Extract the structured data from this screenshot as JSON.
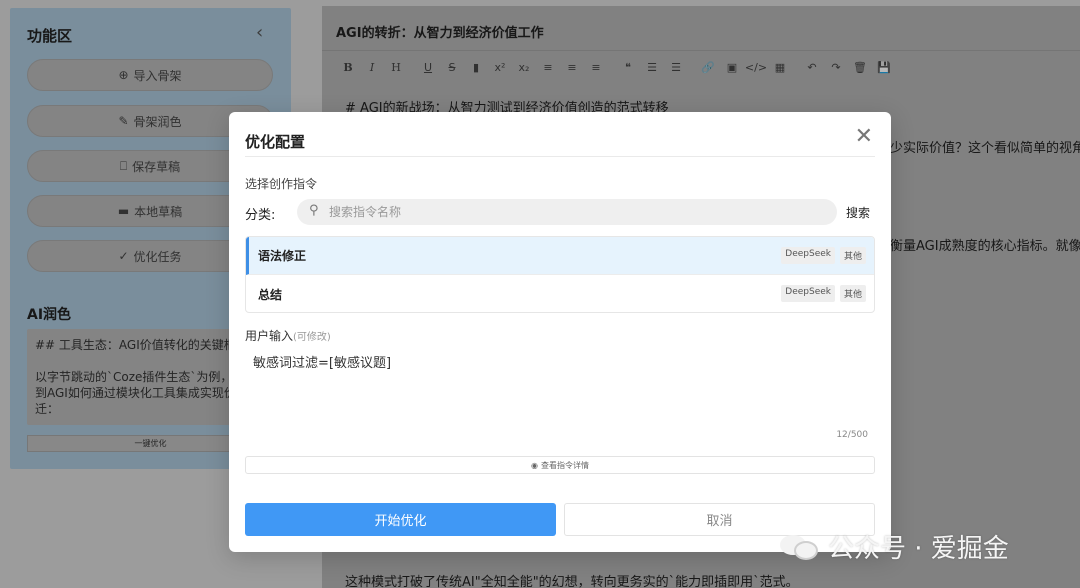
{
  "sidebar": {
    "title": "功能区",
    "buttons": [
      {
        "icon": "plus-circle-icon",
        "glyph": "⊕",
        "label": "导入骨架"
      },
      {
        "icon": "pen-icon",
        "glyph": "✎",
        "label": "骨架润色"
      },
      {
        "icon": "bookmark-icon",
        "glyph": "⎕",
        "label": "保存草稿"
      },
      {
        "icon": "folder-icon",
        "glyph": "▬",
        "label": "本地草稿"
      },
      {
        "icon": "check-circle-icon",
        "glyph": "✓",
        "label": "优化任务"
      }
    ],
    "ai_title": "AI润色",
    "ai_text": "## 工具生态：AGI价值转化的关键枢\n\n以字节跳动的`Coze插件生态`为例，\n到AGI如何通过模块化工具集成实现价\n迁：",
    "one_key": "一键优化"
  },
  "editor": {
    "title": "AGI的转折：从智力到经济价值工作",
    "toolbar": [
      "B",
      "I",
      "H",
      "U",
      "S",
      "▮",
      "x²",
      "x₂",
      "≡",
      "≡",
      "≡",
      "❝",
      "☰",
      "☰",
      "🔗",
      "▣",
      "</>",
      "▦",
      "↶",
      "↷",
      "🗑",
      "💾"
    ],
    "lines": [
      {
        "text": "# AGI的新战场：从智力测试到经济价值创造的范式转移"
      },
      {
        "text": "少实际价值？这个看似简单的视角"
      },
      {
        "text": "衡量AGI成熟度的核心指标。就像"
      },
      {
        "text": "这种模式打破了传统AI\"全知全能\"的幻想，转向更务实的`能力即插即用`范式。"
      }
    ]
  },
  "modal": {
    "title": "优化配置",
    "section_label": "选择创作指令",
    "category_label": "分类:",
    "search_placeholder": "搜索指令名称",
    "search_button": "搜索",
    "items": [
      {
        "name": "语法修正",
        "tags": [
          "DeepSeek",
          "其他"
        ],
        "active": true
      },
      {
        "name": "总结",
        "tags": [
          "DeepSeek",
          "其他"
        ],
        "active": false
      }
    ],
    "user_input_label": "用户输入",
    "user_input_hint": "(可修改)",
    "user_input_value": "敏感词过滤=[敏感议题]",
    "counter": "12/500",
    "detail_link": "查看指令详情",
    "start_button": "开始优化",
    "cancel_button": "取消"
  },
  "watermark": "公众号 · 爱掘金",
  "colors": {
    "primary": "#4098f5",
    "active_bg": "#e6f3fd",
    "active_border": "#3e8fe6"
  }
}
